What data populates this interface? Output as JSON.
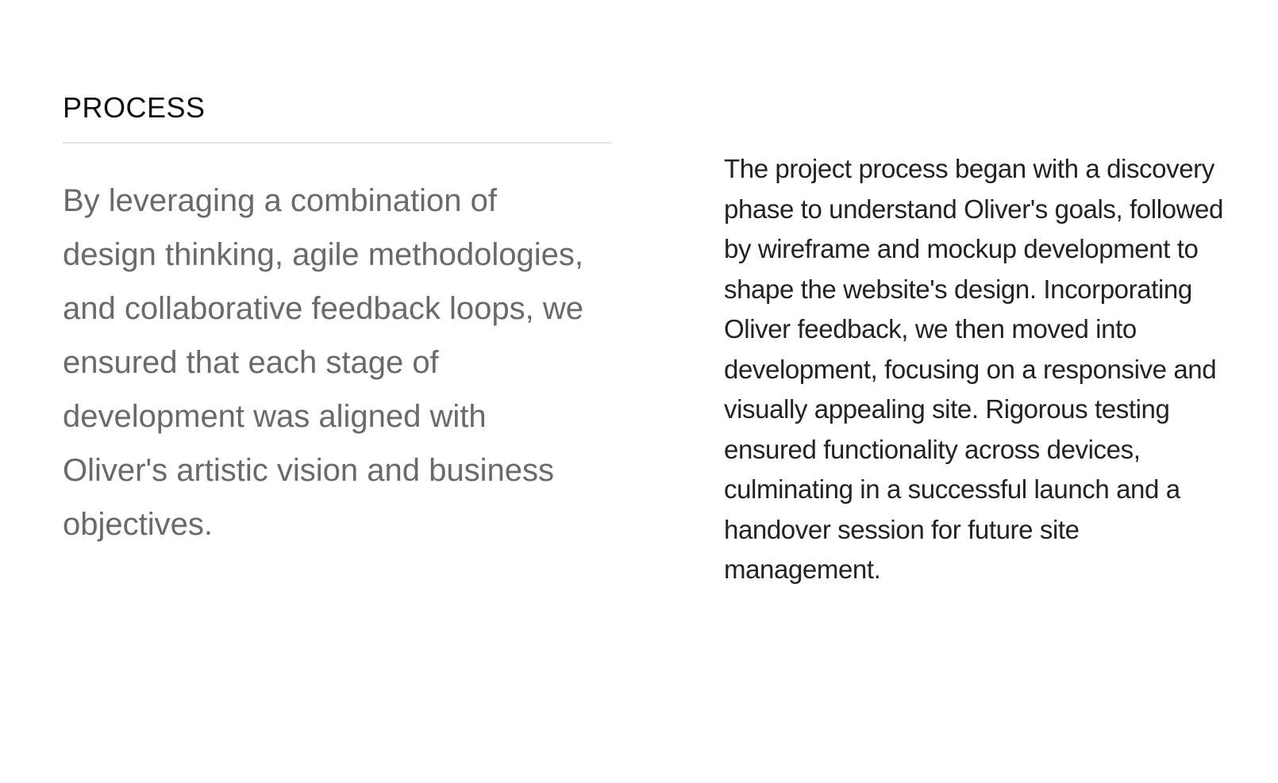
{
  "process": {
    "title": "PROCESS",
    "lead": "By leveraging a combination of design thinking, agile methodologies, and collaborative feedback loops, we ensured that each stage of development was aligned with Oliver's artistic vision and business objectives.",
    "body": "The project process began with a discovery phase to understand Oliver's goals, followed by wireframe and mockup development to shape the website's design. Incorporating Oliver feedback, we then moved into development, focusing on a responsive and visually appealing site. Rigorous testing ensured functionality across devices, culminating in a successful launch and a handover session for future site management."
  }
}
